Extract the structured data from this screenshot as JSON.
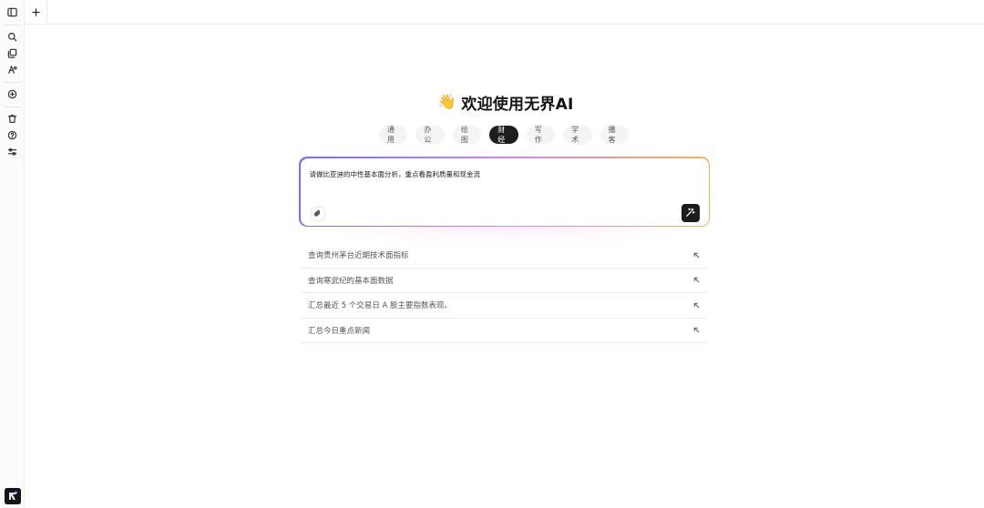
{
  "sidebar": {
    "icons": [
      "panel-toggle-icon",
      "search-icon",
      "copy-icon",
      "agent-icon",
      "add-circle-icon",
      "trash-icon",
      "help-icon",
      "settings-sliders-icon"
    ]
  },
  "topbar": {
    "new_tab_icon": "plus-icon"
  },
  "main": {
    "welcome_emoji": "👋",
    "welcome_title": "欢迎使用无界AI",
    "tabs": [
      {
        "label": "通用",
        "active": false
      },
      {
        "label": "办公",
        "active": false
      },
      {
        "label": "绘图",
        "active": false
      },
      {
        "label": "财经",
        "active": true
      },
      {
        "label": "写作",
        "active": false
      },
      {
        "label": "学术",
        "active": false
      },
      {
        "label": "播客",
        "active": false
      }
    ],
    "prompt_value": "请做比亚迪的中性基本面分析，重点看盈利质量和现金流",
    "suggestions": [
      "查询贵州茅台近期技术面指标",
      "查询寒武纪的基本面数据",
      "汇总最近 5 个交易日 A 股主要指数表现。",
      "汇总今日重点新闻"
    ]
  },
  "colors": {
    "accent_dark": "#1d1d1d",
    "gradient_start": "#7b6cf0",
    "gradient_mid": "#c58be6",
    "gradient_end": "#f6b35a"
  }
}
